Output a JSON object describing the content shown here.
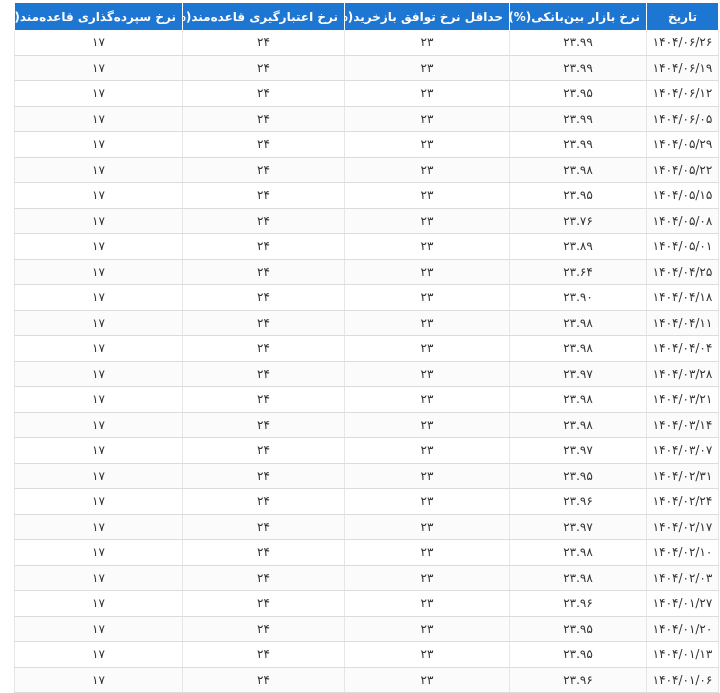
{
  "table": {
    "headers": {
      "deposit": "نرخ سپرده‌گذاری قاعده‌مند(%)",
      "credit": "نرخ اعتبارگیری قاعده‌مند(%)",
      "repo": "حداقل نرخ توافق بازخرید(%)",
      "interbank": "نرخ بازار بین‌بانکی(%)",
      "date": "تاریخ"
    },
    "rows": [
      {
        "date": "۱۴۰۴/۰۶/۲۶",
        "interbank": "۲۳.۹۹",
        "repo": "۲۳",
        "credit": "۲۴",
        "deposit": "۱۷"
      },
      {
        "date": "۱۴۰۴/۰۶/۱۹",
        "interbank": "۲۳.۹۹",
        "repo": "۲۳",
        "credit": "۲۴",
        "deposit": "۱۷"
      },
      {
        "date": "۱۴۰۴/۰۶/۱۲",
        "interbank": "۲۳.۹۵",
        "repo": "۲۳",
        "credit": "۲۴",
        "deposit": "۱۷"
      },
      {
        "date": "۱۴۰۴/۰۶/۰۵",
        "interbank": "۲۳.۹۹",
        "repo": "۲۳",
        "credit": "۲۴",
        "deposit": "۱۷"
      },
      {
        "date": "۱۴۰۴/۰۵/۲۹",
        "interbank": "۲۳.۹۹",
        "repo": "۲۳",
        "credit": "۲۴",
        "deposit": "۱۷"
      },
      {
        "date": "۱۴۰۴/۰۵/۲۲",
        "interbank": "۲۳.۹۸",
        "repo": "۲۳",
        "credit": "۲۴",
        "deposit": "۱۷"
      },
      {
        "date": "۱۴۰۴/۰۵/۱۵",
        "interbank": "۲۳.۹۵",
        "repo": "۲۳",
        "credit": "۲۴",
        "deposit": "۱۷"
      },
      {
        "date": "۱۴۰۴/۰۵/۰۸",
        "interbank": "۲۳.۷۶",
        "repo": "۲۳",
        "credit": "۲۴",
        "deposit": "۱۷"
      },
      {
        "date": "۱۴۰۴/۰۵/۰۱",
        "interbank": "۲۳.۸۹",
        "repo": "۲۳",
        "credit": "۲۴",
        "deposit": "۱۷"
      },
      {
        "date": "۱۴۰۴/۰۴/۲۵",
        "interbank": "۲۳.۶۴",
        "repo": "۲۳",
        "credit": "۲۴",
        "deposit": "۱۷"
      },
      {
        "date": "۱۴۰۴/۰۴/۱۸",
        "interbank": "۲۳.۹۰",
        "repo": "۲۳",
        "credit": "۲۴",
        "deposit": "۱۷"
      },
      {
        "date": "۱۴۰۴/۰۴/۱۱",
        "interbank": "۲۳.۹۸",
        "repo": "۲۳",
        "credit": "۲۴",
        "deposit": "۱۷"
      },
      {
        "date": "۱۴۰۴/۰۴/۰۴",
        "interbank": "۲۳.۹۸",
        "repo": "۲۳",
        "credit": "۲۴",
        "deposit": "۱۷"
      },
      {
        "date": "۱۴۰۴/۰۳/۲۸",
        "interbank": "۲۳.۹۷",
        "repo": "۲۳",
        "credit": "۲۴",
        "deposit": "۱۷"
      },
      {
        "date": "۱۴۰۴/۰۳/۲۱",
        "interbank": "۲۳.۹۸",
        "repo": "۲۳",
        "credit": "۲۴",
        "deposit": "۱۷"
      },
      {
        "date": "۱۴۰۴/۰۳/۱۴",
        "interbank": "۲۳.۹۸",
        "repo": "۲۳",
        "credit": "۲۴",
        "deposit": "۱۷"
      },
      {
        "date": "۱۴۰۴/۰۳/۰۷",
        "interbank": "۲۳.۹۷",
        "repo": "۲۳",
        "credit": "۲۴",
        "deposit": "۱۷"
      },
      {
        "date": "۱۴۰۴/۰۲/۳۱",
        "interbank": "۲۳.۹۵",
        "repo": "۲۳",
        "credit": "۲۴",
        "deposit": "۱۷"
      },
      {
        "date": "۱۴۰۴/۰۲/۲۴",
        "interbank": "۲۳.۹۶",
        "repo": "۲۳",
        "credit": "۲۴",
        "deposit": "۱۷"
      },
      {
        "date": "۱۴۰۴/۰۲/۱۷",
        "interbank": "۲۳.۹۷",
        "repo": "۲۳",
        "credit": "۲۴",
        "deposit": "۱۷"
      },
      {
        "date": "۱۴۰۴/۰۲/۱۰",
        "interbank": "۲۳.۹۸",
        "repo": "۲۳",
        "credit": "۲۴",
        "deposit": "۱۷"
      },
      {
        "date": "۱۴۰۴/۰۲/۰۳",
        "interbank": "۲۳.۹۸",
        "repo": "۲۳",
        "credit": "۲۴",
        "deposit": "۱۷"
      },
      {
        "date": "۱۴۰۴/۰۱/۲۷",
        "interbank": "۲۳.۹۶",
        "repo": "۲۳",
        "credit": "۲۴",
        "deposit": "۱۷"
      },
      {
        "date": "۱۴۰۴/۰۱/۲۰",
        "interbank": "۲۳.۹۵",
        "repo": "۲۳",
        "credit": "۲۴",
        "deposit": "۱۷"
      },
      {
        "date": "۱۴۰۴/۰۱/۱۳",
        "interbank": "۲۳.۹۵",
        "repo": "۲۳",
        "credit": "۲۴",
        "deposit": "۱۷"
      },
      {
        "date": "۱۴۰۴/۰۱/۰۶",
        "interbank": "۲۳.۹۶",
        "repo": "۲۳",
        "credit": "۲۴",
        "deposit": "۱۷"
      }
    ]
  },
  "colors": {
    "header_bg": "#1d76d2",
    "header_text": "#ffffff",
    "row_border": "#dcdcdc"
  }
}
